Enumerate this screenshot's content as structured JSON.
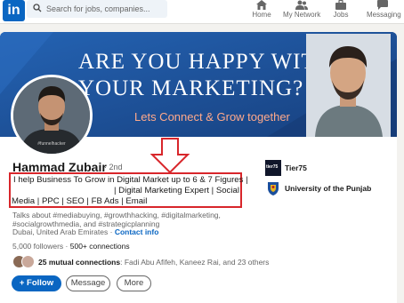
{
  "nav": {
    "logo_text": "in",
    "search_placeholder": "Search for jobs, companies...",
    "items": [
      {
        "label": "Home",
        "icon": "home-icon"
      },
      {
        "label": "My Network",
        "icon": "network-icon"
      },
      {
        "label": "Jobs",
        "icon": "briefcase-icon"
      },
      {
        "label": "Messaging",
        "icon": "messaging-icon"
      }
    ]
  },
  "banner": {
    "line1": "ARE YOU HAPPY  WITH",
    "line2": "YOUR MARKETING?",
    "subtitle": "Lets Connect & Grow together",
    "background_color": "#1f57a3",
    "subtitle_color": "#ffa98b"
  },
  "profile": {
    "name": "Hammad Zubair",
    "degree": "· 2nd",
    "headline_line1": "I help Business To Grow in Digital Market up to 6 & 7 Figures |",
    "headline_line2": "| Digital Marketing Expert | Social",
    "headline_line3": "Media | PPC | SEO | FB Ads | Email",
    "talks_about_line1": "Talks about #mediabuying, #growthhacking, #digitalmarketing,",
    "talks_about_line2": "#socialgrowthmedia, and #strategicplanning",
    "location": "Dubai, United Arab Emirates",
    "location_separator": " · ",
    "contact_info": "Contact info",
    "followers": "5,000 followers",
    "connections_separator": " · ",
    "connections": "500+ connections",
    "mutual_count": "25 mutual connections",
    "mutual_names": ": Fadi Abu Afifeh, Kaneez Rai, and 23 others"
  },
  "actions": {
    "follow": "+ Follow",
    "message": "Message",
    "more": "More"
  },
  "experience": [
    {
      "name": "Tier75",
      "logo_text": "tier75",
      "icon": "tier75-logo-icon"
    },
    {
      "name": "University of the Punjab",
      "icon": "university-crest-icon"
    }
  ],
  "colors": {
    "accent": "#0a66c2",
    "highlight_box": "#d8262b"
  }
}
